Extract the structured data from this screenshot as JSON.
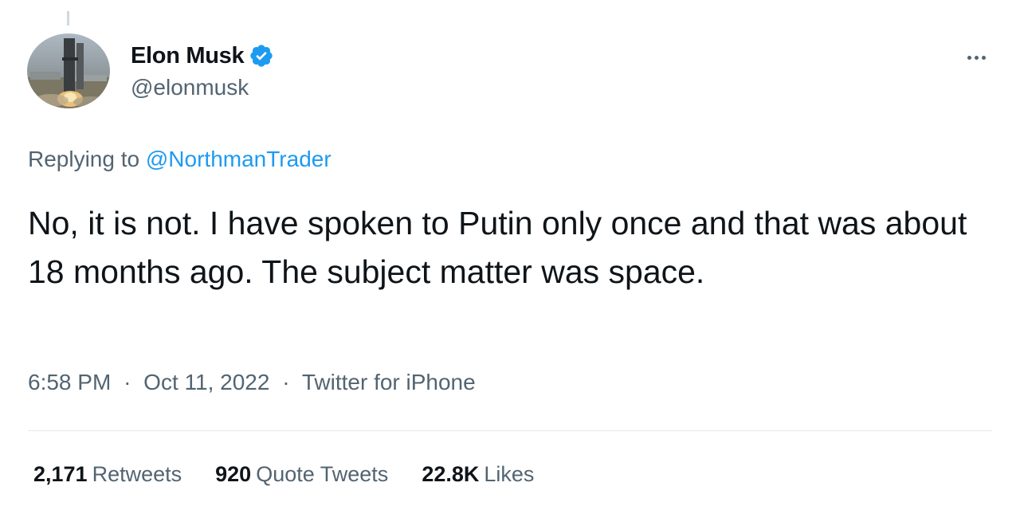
{
  "tweet": {
    "author": {
      "display_name": "Elon Musk",
      "handle": "@elonmusk",
      "verified": true,
      "avatar_icon": "rocket-launch-avatar"
    },
    "more_icon": "ellipsis-icon",
    "replying_prefix": "Replying to",
    "replying_to": "@NorthmanTrader",
    "text": "No, it is not. I have spoken to Putin only once and that was about 18 months ago. The subject matter was space.",
    "meta": {
      "time": "6:58 PM",
      "separator": "·",
      "date": "Oct 11, 2022",
      "source": "Twitter for iPhone"
    },
    "stats": {
      "retweets_count": "2,171",
      "retweets_label": "Retweets",
      "quotes_count": "920",
      "quotes_label": "Quote Tweets",
      "likes_count": "22.8K",
      "likes_label": "Likes"
    }
  },
  "colors": {
    "text_primary": "#0f1419",
    "text_secondary": "#536471",
    "link_blue": "#1d9bf0",
    "verified_blue": "#1d9bf0",
    "divider": "#e5e9ec"
  }
}
